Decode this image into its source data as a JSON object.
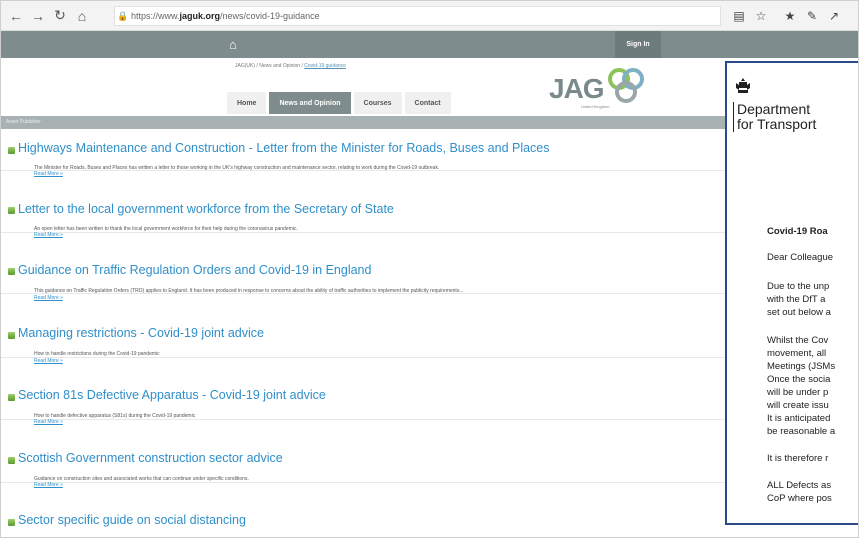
{
  "browser": {
    "url_prefix": "https://www.",
    "url_domain": "jaguk.org",
    "url_path": "/news/covid-19-guidance"
  },
  "site": {
    "signin": "Sign In",
    "breadcrumb": {
      "part1": "JAG(UK)",
      "sep1": " / ",
      "part2": "News and Opinion",
      "sep2": " / ",
      "current": "Covid-19 guidance"
    },
    "logo_text": "JAG",
    "logo_sub": "United Kingdom",
    "menu": [
      "Home",
      "News and Opinion",
      "Courses",
      "Contact"
    ],
    "publisher_bar": "Asset Publisher"
  },
  "articles": [
    {
      "title": "Highways Maintenance and Construction - Letter from the Minister for Roads, Buses and Places",
      "desc": "The Minister for Roads, Buses and Places has written a letter to those working in the UK's highway construction and maintenance sector, relating to work during the Covid-19 outbreak.",
      "more": "Read More »"
    },
    {
      "title": "Letter to the local government workforce from the Secretary of State",
      "desc": "An open letter has been written to thank the local government workforce for their help during the coronavirus pandemic.",
      "more": "Read More »"
    },
    {
      "title": "Guidance on Traffic Regulation Orders and Covid-19 in England",
      "desc": "This guidance on Traffic Regulation Orders (TRO) applies to England. It has been produced in response to concerns about the ability of traffic authorities to implement the publicity requirements...",
      "more": "Read More »"
    },
    {
      "title": "Managing restrictions - Covid-19 joint advice",
      "desc": "How to handle restrictions during the Covid-19 pandemic",
      "more": "Read More »"
    },
    {
      "title": "Section 81s Defective Apparatus - Covid-19 joint advice",
      "desc": "How to handle defective apparatus (S81s) during the Covid-19 pandemic",
      "more": "Read More »"
    },
    {
      "title": "Scottish Government construction sector advice",
      "desc": "Guidance on construction sites and associated works that can continue under specific conditions.",
      "more": "Read More »"
    },
    {
      "title": "Sector specific guide on social distancing",
      "desc": "",
      "more": ""
    }
  ],
  "letter": {
    "dept_line1": "Department",
    "dept_line2": "for Transport",
    "lines": [
      "Covid-19 Roa",
      "Dear Colleague",
      "Due to the unp",
      "with the DfT a",
      "set out below a",
      "Whilst the Cov",
      "movement, all",
      "Meetings (JSMs",
      "Once the socia",
      "will be under p",
      "will create issu",
      "It is anticipated",
      "be reasonable a",
      "It is therefore r",
      "ALL Defects as",
      "CoP where pos"
    ]
  }
}
